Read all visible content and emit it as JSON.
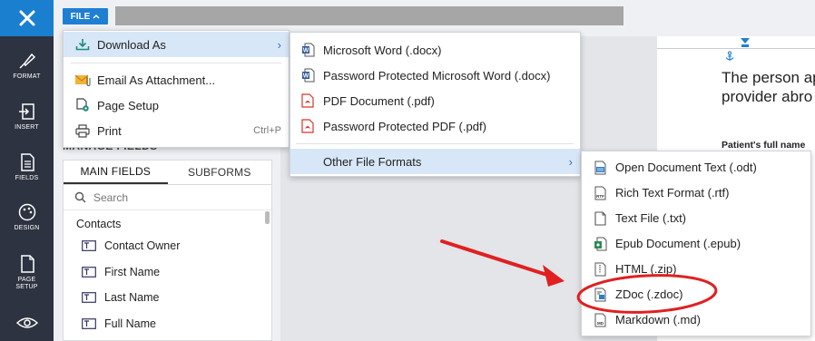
{
  "topbar": {
    "file_label": "FILE"
  },
  "rail": {
    "items": [
      {
        "label": "FORMAT"
      },
      {
        "label": "INSERT"
      },
      {
        "label": "FIELDS"
      },
      {
        "label": "DESIGN"
      },
      {
        "label": "PAGE SETUP"
      }
    ]
  },
  "fields_panel": {
    "heading": "MANAGE FIELDS",
    "tabs": [
      "MAIN FIELDS",
      "SUBFORMS"
    ],
    "search_placeholder": "Search",
    "group": "Contacts",
    "fields": [
      "Contact Owner",
      "First Name",
      "Last Name",
      "Full Name"
    ]
  },
  "document": {
    "line1": "The person ap",
    "line2": "provider abro",
    "bold_label": "Patient's full name"
  },
  "file_menu": {
    "items": [
      {
        "label": "Download As",
        "icon": "download-icon"
      },
      {
        "label": "Email As Attachment...",
        "icon": "email-attachment-icon"
      },
      {
        "label": "Page Setup",
        "icon": "page-setup-icon"
      },
      {
        "label": "Print",
        "icon": "printer-icon",
        "shortcut": "Ctrl+P"
      }
    ]
  },
  "download_menu": {
    "items": [
      {
        "label": "Microsoft Word (.docx)",
        "icon": "word-doc-icon"
      },
      {
        "label": "Password Protected Microsoft Word (.docx)",
        "icon": "word-doc-icon"
      },
      {
        "label": "PDF Document (.pdf)",
        "icon": "pdf-icon"
      },
      {
        "label": "Password Protected PDF (.pdf)",
        "icon": "pdf-icon"
      },
      {
        "label": "Other File Formats",
        "icon": ""
      }
    ]
  },
  "other_formats_menu": {
    "items": [
      {
        "label": "Open Document Text (.odt)",
        "icon": "odt-icon"
      },
      {
        "label": "Rich Text Format (.rtf)",
        "icon": "rtf-icon"
      },
      {
        "label": "Text File (.txt)",
        "icon": "text-file-icon"
      },
      {
        "label": "Epub Document (.epub)",
        "icon": "epub-icon"
      },
      {
        "label": "HTML (.zip)",
        "icon": "html-zip-icon"
      },
      {
        "label": "ZDoc (.zdoc)",
        "icon": "zdoc-icon"
      },
      {
        "label": "Markdown (.md)",
        "icon": "markdown-icon"
      }
    ]
  },
  "colors": {
    "accent": "#1f7fd3",
    "rail": "#2d3340",
    "highlight": "#d8e7f8",
    "annotation": "#e02020"
  }
}
